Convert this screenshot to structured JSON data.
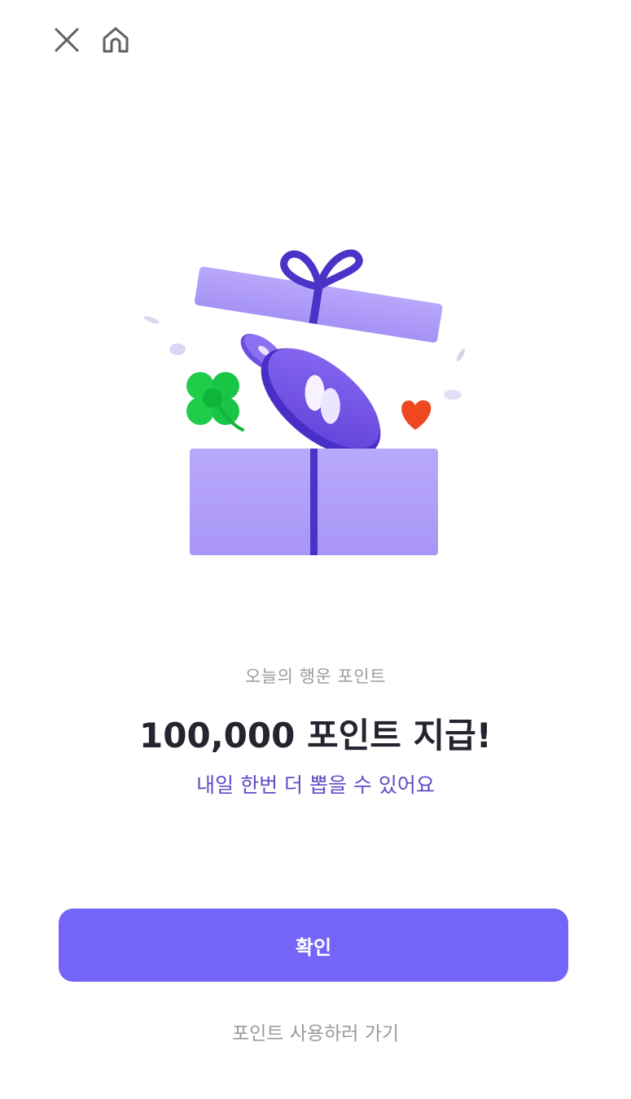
{
  "colors": {
    "accent": "#7464f7",
    "headline": "#25252f",
    "note": "#5e4cc6",
    "muted": "#9a9aa2"
  },
  "header": {
    "close_icon": "close-icon",
    "home_icon": "home-icon"
  },
  "illustration": {
    "name": "open-gift-box-with-coins"
  },
  "result": {
    "subtitle": "오늘의 행운 포인트",
    "headline": "100,000 포인트 지급!",
    "note": "내일 한번 더 뽑을 수 있어요"
  },
  "actions": {
    "confirm_label": "확인",
    "use_points_link": "포인트 사용하러 가기"
  }
}
